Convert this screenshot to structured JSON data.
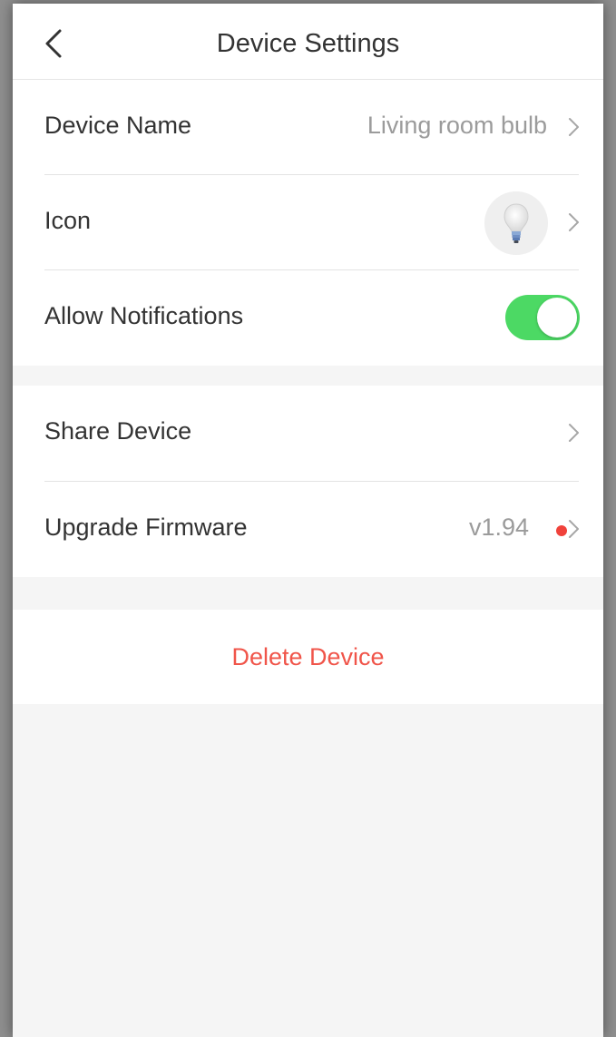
{
  "header": {
    "title": "Device Settings",
    "back_icon": "chevron-left-icon"
  },
  "settings": {
    "device_name": {
      "label": "Device Name",
      "value": "Living room bulb"
    },
    "icon": {
      "label": "Icon",
      "icon_name": "light-bulb-icon"
    },
    "notifications": {
      "label": "Allow Notifications",
      "enabled": true
    }
  },
  "device": {
    "share": {
      "label": "Share Device"
    },
    "firmware": {
      "label": "Upgrade Firmware",
      "version": "v1.94",
      "update_available": true
    }
  },
  "delete": {
    "label": "Delete Device"
  },
  "colors": {
    "toggle_on": "#4cd964",
    "danger": "#f0554a",
    "update_dot": "#f0423b",
    "background": "#f5f5f5"
  }
}
